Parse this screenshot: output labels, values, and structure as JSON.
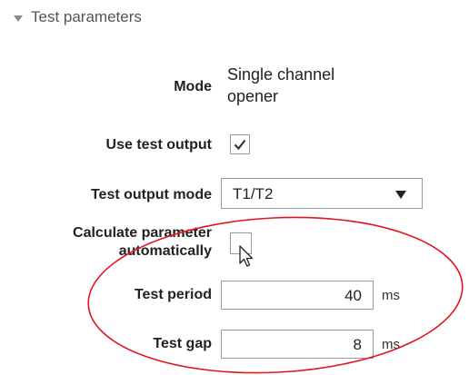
{
  "section": {
    "title": "Test parameters",
    "expanded": true
  },
  "fields": {
    "mode": {
      "label": "Mode",
      "value_line1": "Single channel",
      "value_line2": "opener"
    },
    "use_test_output": {
      "label": "Use test output",
      "checked": true
    },
    "test_output_mode": {
      "label": "Test output mode",
      "value": "T1/T2"
    },
    "calculate_automatically": {
      "label_line1": "Calculate parameter",
      "label_line2": "automatically",
      "checked": false
    },
    "test_period": {
      "label": "Test period",
      "value": "40",
      "unit": "ms"
    },
    "test_gap": {
      "label": "Test gap",
      "value": "8",
      "unit": "ms"
    }
  },
  "icons": {
    "section_toggle": "triangle-down-icon",
    "check": "checkmark-icon",
    "dropdown": "chevron-down-icon",
    "cursor": "mouse-pointer-icon"
  },
  "colors": {
    "annotation": "#e0161e",
    "border": "#9a9a9a",
    "text": "#222222"
  }
}
